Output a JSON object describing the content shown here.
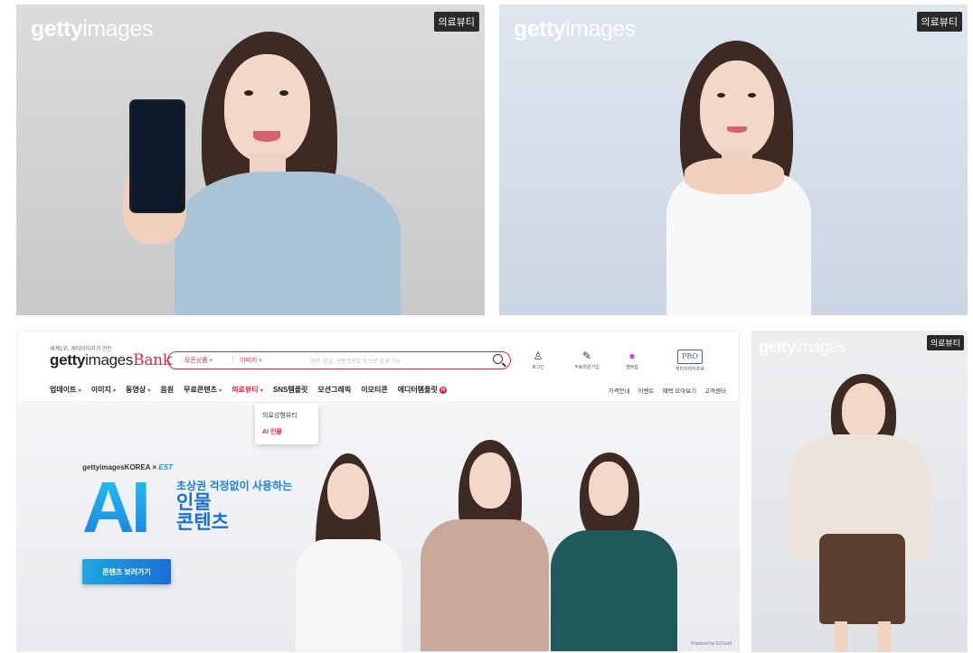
{
  "photos": {
    "top_left": {
      "watermark_bold": "getty",
      "watermark_light": "images",
      "badge": "의료뷰티"
    },
    "top_right": {
      "watermark_bold": "getty",
      "watermark_light": "images",
      "badge": "의료뷰티"
    },
    "bottom_right": {
      "watermark_bold": "getty",
      "watermark_light": "images",
      "badge": "의료뷰티"
    }
  },
  "site": {
    "tagline": "세계1위, 게티이미지가 만든",
    "logo_bold": "getty",
    "logo_light": "images",
    "logo_bank": "Bank",
    "search": {
      "category": "모든상품",
      "type": "이미지",
      "placeholder": "영문, 한글, 콘텐츠번호 등으로 검색 가능"
    },
    "utility": [
      {
        "icon": "user-icon",
        "glyph": "♙",
        "label": "로그인"
      },
      {
        "icon": "pen-icon",
        "glyph": "✎",
        "label": "무료회원가입"
      },
      {
        "icon": "membership-icon",
        "glyph": "●",
        "label": "멤버쉽"
      },
      {
        "icon": "pro-icon",
        "glyph": "PRO",
        "label": "게티이미지프로"
      }
    ],
    "nav": {
      "items": [
        "업데이트",
        "이미지",
        "동영상",
        "음원",
        "무료콘텐츠",
        "의료뷰티",
        "SNS템플릿",
        "모션그래픽",
        "이모티콘",
        "에디터템플릿"
      ],
      "right": [
        "가격안내",
        "이벤트",
        "혜택 모아보기",
        "고객센터"
      ],
      "new_badge": "N"
    },
    "dropdown": [
      "의료성형뷰티",
      "AI 인물"
    ],
    "hero": {
      "brand": "gettyimagesKOREA × ",
      "brand_partner": "EST",
      "ai": "AI",
      "subtitle": "초상권 걱정없이 사용하는",
      "title_line1": "인물",
      "title_line2": "콘텐츠",
      "button": "콘텐츠 보러가기",
      "powered": "Powered by ESTsoft"
    }
  }
}
